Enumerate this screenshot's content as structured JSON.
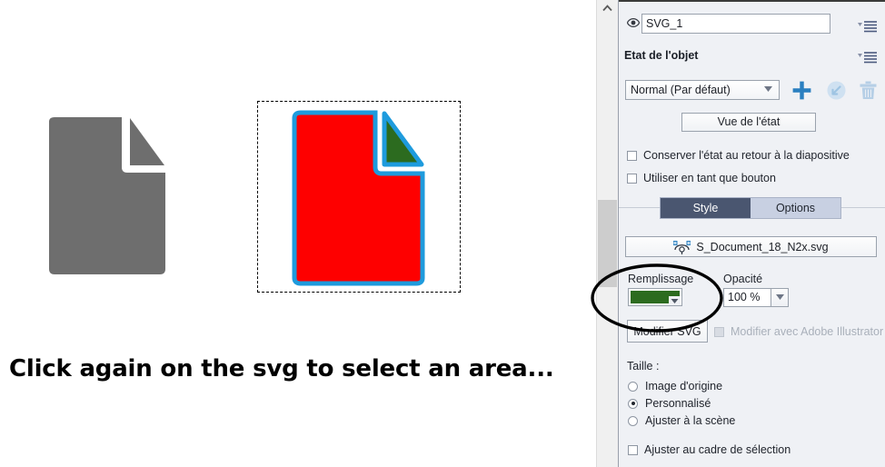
{
  "stage": {
    "caption": "Click again on the svg to select an area...",
    "objects": [
      {
        "name": "document-icon-gray",
        "fill": "#6e6e6e",
        "corner_fill": "#6e6e6e",
        "selected": false
      },
      {
        "name": "document-icon-red",
        "fill": "#fe0000",
        "corner_fill": "#2c6b1f",
        "stroke": "#1e9bdd",
        "selected": true
      }
    ],
    "selection_frame": {
      "style": "dashed",
      "color": "#000000"
    }
  },
  "scrollbar": {
    "up_arrow_icon": "chevron-up-icon",
    "orientation": "vertical"
  },
  "panel": {
    "object_name": {
      "value": "SVG_1",
      "placeholder": "SVG_1",
      "visibility_icon": "eye-icon"
    },
    "flyout_icon": "flyout-menu-icon",
    "section_title": "Etat de l'objet",
    "state": {
      "selected": "Normal (Par défaut)",
      "options": [
        "Normal (Par défaut)"
      ],
      "dropdown_icon": "chevron-down-icon",
      "add_icon": "plus-icon",
      "reset_icon": "reset-state-icon",
      "delete_icon": "trash-icon"
    },
    "view_state_button": "Vue de l'état",
    "checkboxes": [
      {
        "label": "Conserver l'état au retour à la diapositive",
        "checked": false,
        "disabled": false
      },
      {
        "label": "Utiliser en tant que bouton",
        "checked": false,
        "disabled": false
      }
    ],
    "tabs": [
      {
        "label": "Style",
        "active": true
      },
      {
        "label": "Options",
        "active": false
      }
    ],
    "svg_file": {
      "label": "S_Document_18_N2x.svg",
      "icon": "bezier-pen-icon"
    },
    "fill": {
      "label": "Remplissage",
      "color": "#2c6b1f",
      "dropdown_icon": "chevron-down-icon"
    },
    "opacity": {
      "label": "Opacité",
      "value": "100 %",
      "dropdown_icon": "chevron-down-icon"
    },
    "modify_svg_button": "Modifier SVG",
    "illustrator_checkbox": {
      "label": "Modifier avec Adobe Illustrator",
      "checked": false,
      "disabled": true
    },
    "size": {
      "label": "Taille :",
      "options": [
        {
          "label": "Image d'origine",
          "selected": false
        },
        {
          "label": "Personnalisé",
          "selected": true
        },
        {
          "label": "Ajuster à la scène",
          "selected": false
        }
      ]
    },
    "fit_checkbox": {
      "label": "Ajuster au cadre de sélection",
      "checked": false
    }
  },
  "annotation": {
    "shape": "hand-drawn-ellipse",
    "color": "#000000"
  },
  "colors": {
    "panel_bg": "#eff1f5",
    "tab_active": "#4a5670",
    "tab_strip": "#c8d0e2",
    "accent_blue": "#2a7fc0",
    "icon_blue": "#4b5a7e"
  }
}
